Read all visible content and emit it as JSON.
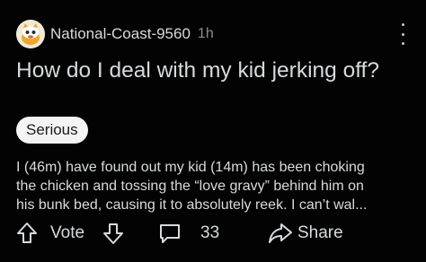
{
  "post": {
    "username": "National-Coast-9560",
    "time": "1h",
    "title": "How do I deal with my kid jerking off?",
    "flair": "Serious",
    "body_lines": [
      "I (46m) have found out my kid (14m) has been choking",
      "the chicken and tossing the “love gravy” behind him on",
      "his bunk bed, causing it to absolutely reek. I can’t wal..."
    ]
  },
  "actions": {
    "vote_label": "Vote",
    "comment_count": "33",
    "share_label": "Share"
  },
  "icons": {
    "avatar": "snoo-avatar-icon",
    "more": "more-options-icon",
    "upvote": "upvote-arrow-icon",
    "downvote": "downvote-arrow-icon",
    "comment": "comment-bubble-icon",
    "share": "share-arrow-icon"
  },
  "colors": {
    "background": "#030303",
    "text": "#d7dadc",
    "muted": "#8a8c8e",
    "flair_bg": "#f4f4f4"
  }
}
